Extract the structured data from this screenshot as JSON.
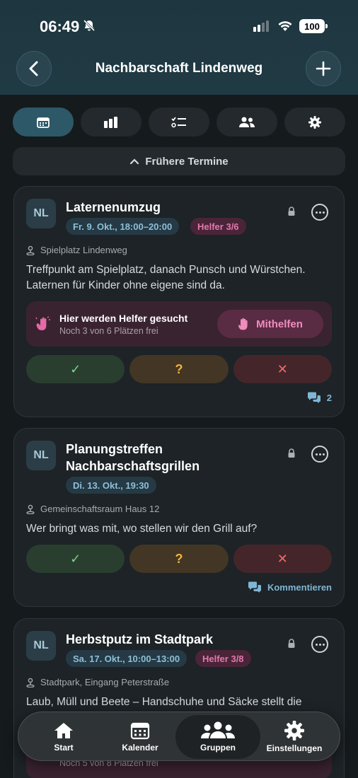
{
  "status": {
    "time": "06:49",
    "battery": "100"
  },
  "header": {
    "title": "Nachbarschaft Lindenweg"
  },
  "segments": [
    "calendar-icon",
    "chart-icon",
    "checklist-icon",
    "members-icon",
    "gear-icon"
  ],
  "earlier_label": "Frühere Termine",
  "events": [
    {
      "avatar": "NL",
      "title": "Laternenumzug",
      "date": "Fr. 9. Okt., 18:00–20:00",
      "helper_badge": "Helfer 3/6",
      "location": "Spielplatz Lindenweg",
      "description": "Treffpunkt am Spielplatz, danach Punsch und Würstchen. Laternen für Kinder ohne eigene sind da.",
      "helper_title": "Hier werden Helfer gesucht",
      "helper_sub": "Noch 3 von 6 Plätzen frei",
      "helper_button": "Mithelfen",
      "comment_count": "2"
    },
    {
      "avatar": "NL",
      "title_line1": "Planungstreffen",
      "title_line2": "Nachbarschaftsgrillen",
      "date": "Di. 13. Okt., 19:30",
      "location": "Gemeinschaftsraum Haus 12",
      "description": "Wer bringt was mit, wo stellen wir den Grill auf?",
      "comment_label": "Kommentieren"
    },
    {
      "avatar": "NL",
      "title": "Herbstputz im Stadtpark",
      "date": "Sa. 17. Okt., 10:00–13:00",
      "helper_badge": "Helfer 3/8",
      "location": "Stadtpark, Eingang Peterstraße",
      "description": "Laub, Müll und Beete – Handschuhe und Säcke stellt die",
      "helper_sub": "Noch 5 von 8 Plätzen frei"
    }
  ],
  "rsvp": {
    "yes": "✓",
    "maybe": "?",
    "no": "✕"
  },
  "tabbar": {
    "start": "Start",
    "calendar": "Kalender",
    "groups": "Gruppen",
    "settings": "Einstellungen"
  }
}
